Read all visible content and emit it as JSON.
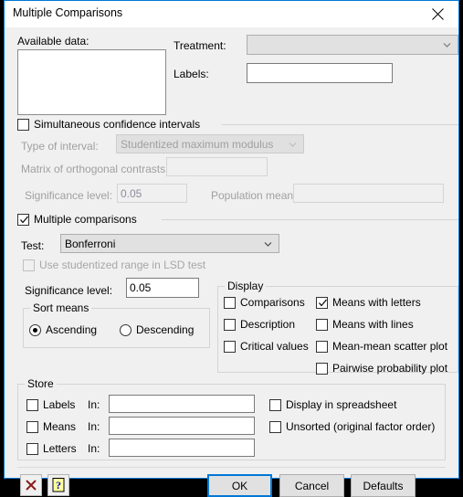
{
  "window": {
    "title": "Multiple Comparisons",
    "close_icon": "close-icon",
    "border_color": "#0078d7"
  },
  "available_data": {
    "label": "Available data:",
    "value": ""
  },
  "treatment": {
    "label": "Treatment:",
    "value": "",
    "arrow_icon": "chevron-down-icon"
  },
  "labels_field": {
    "label": "Labels:",
    "value": ""
  },
  "confidence_intervals": {
    "header_label": "Simultaneous confidence intervals",
    "checked": false,
    "enabled": false,
    "type_of_interval": {
      "label": "Type of interval:",
      "value": "Studentized maximum modulus",
      "arrow_icon": "chevron-down-icon"
    },
    "matrix_contrasts": {
      "label": "Matrix of orthogonal contrasts:",
      "value": ""
    },
    "significance_level": {
      "label": "Significance level:",
      "value": "0.05"
    },
    "population_mean": {
      "label": "Population mean:",
      "value": ""
    }
  },
  "multiple_comparisons": {
    "header_label": "Multiple comparisons",
    "checked": true,
    "test": {
      "label": "Test:",
      "value": "Bonferroni",
      "arrow_icon": "chevron-down-icon"
    },
    "use_studentized_range": {
      "label": "Use studentized range in LSD test",
      "checked": false,
      "enabled": false
    },
    "significance_level": {
      "label": "Significance level:",
      "value": "0.05"
    },
    "sort_means": {
      "title": "Sort means",
      "options": [
        {
          "label": "Ascending",
          "selected": true
        },
        {
          "label": "Descending",
          "selected": false
        }
      ]
    },
    "display": {
      "title": "Display",
      "left_column": [
        {
          "label": "Comparisons",
          "checked": false
        },
        {
          "label": "Description",
          "checked": false
        },
        {
          "label": "Critical values",
          "checked": false
        }
      ],
      "right_column": [
        {
          "label": "Means with letters",
          "checked": true
        },
        {
          "label": "Means with lines",
          "checked": false
        },
        {
          "label": "Mean-mean scatter plot",
          "checked": false
        },
        {
          "label": "Pairwise probability plot",
          "checked": false
        }
      ]
    }
  },
  "store": {
    "title": "Store",
    "rows": [
      {
        "label": "Labels",
        "checked": false,
        "in_label": "In:",
        "value": ""
      },
      {
        "label": "Means",
        "checked": false,
        "in_label": "In:",
        "value": ""
      },
      {
        "label": "Letters",
        "checked": false,
        "in_label": "In:",
        "value": ""
      }
    ],
    "options": [
      {
        "label": "Display in spreadsheet",
        "checked": false
      },
      {
        "label": "Unsorted (original factor order)",
        "checked": false
      }
    ]
  },
  "footer": {
    "cancel_icon_button": "red-x-icon",
    "help_icon_button": "help-question-icon",
    "ok_label": "OK",
    "cancel_label": "Cancel",
    "defaults_label": "Defaults"
  }
}
